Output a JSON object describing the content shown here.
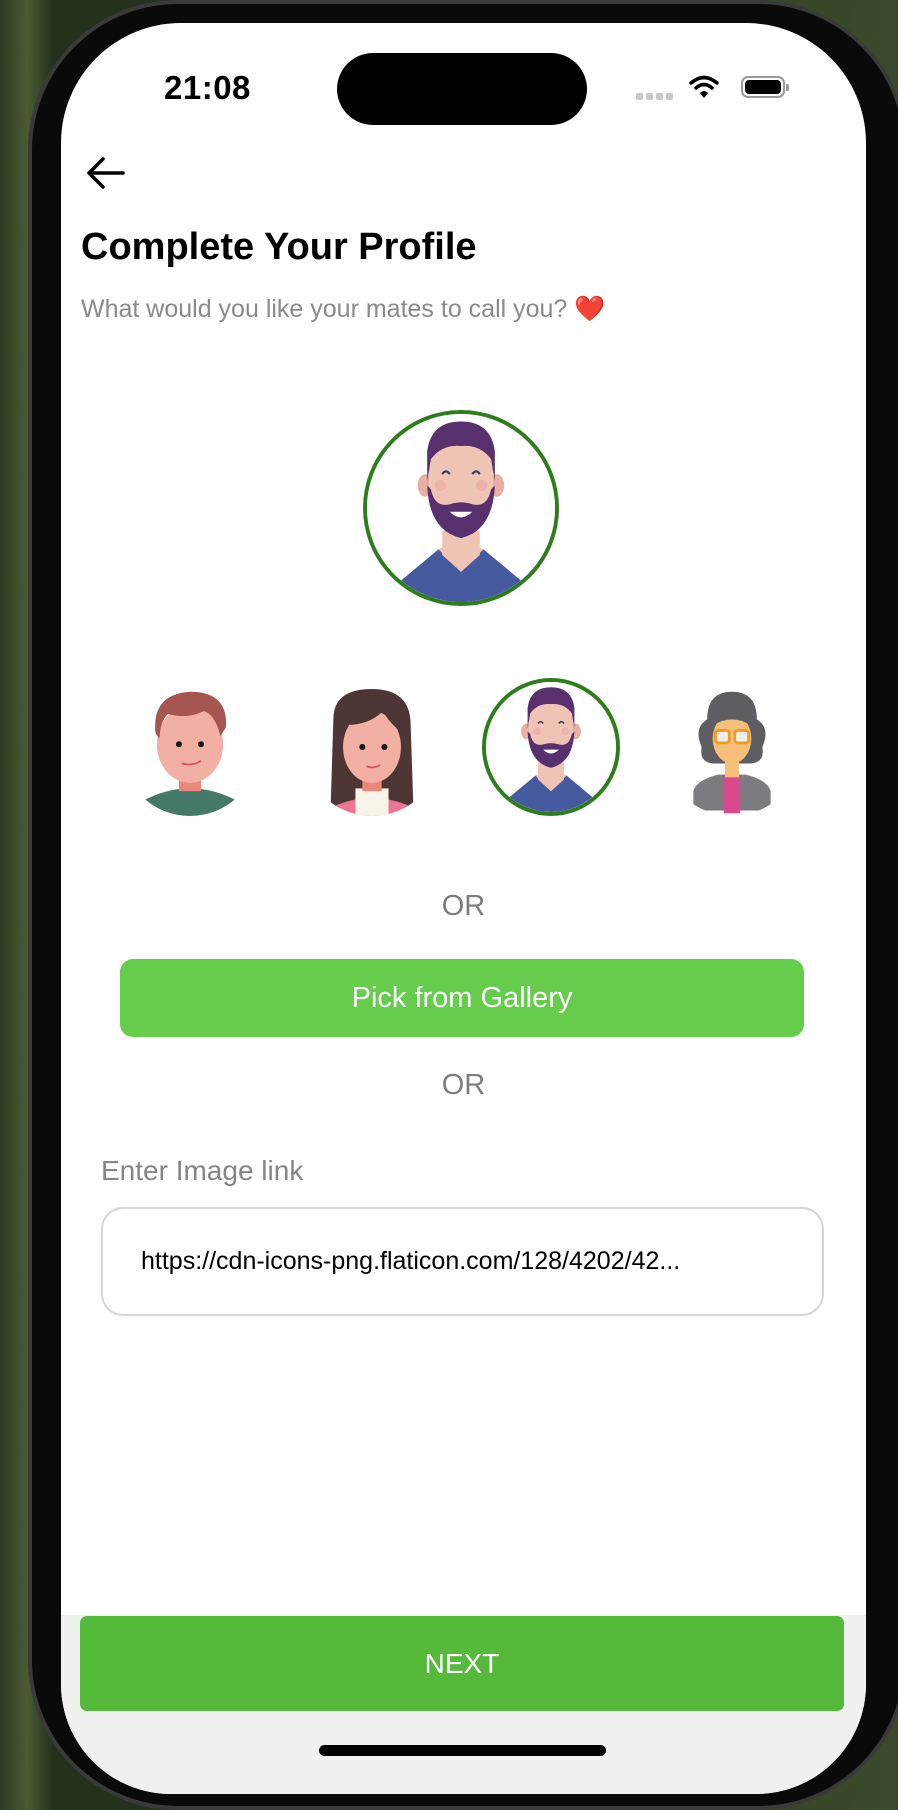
{
  "status_bar": {
    "time": "21:08",
    "icons": [
      "cellular-signal-icon",
      "wifi-icon",
      "battery-icon"
    ]
  },
  "header": {
    "back_icon": "arrow-left-icon",
    "title": "Complete Your Profile",
    "subtitle": "What would you like your mates to call you?",
    "subtitle_emoji": "❤️"
  },
  "avatars": {
    "selected_index": 2,
    "items": [
      {
        "name": "boy-avatar"
      },
      {
        "name": "girl-avatar"
      },
      {
        "name": "bearded-man-avatar"
      },
      {
        "name": "woman-glasses-avatar"
      }
    ]
  },
  "separator_1": "OR",
  "gallery_button": "Pick from Gallery",
  "separator_2": "OR",
  "image_link": {
    "label": "Enter Image link",
    "value": "https://cdn-icons-png.flaticon.com/128/4202/42..."
  },
  "next_button": "NEXT",
  "colors": {
    "accent": "#66cd4c",
    "next": "#55b93a",
    "selected_ring": "#2e7d1c"
  }
}
